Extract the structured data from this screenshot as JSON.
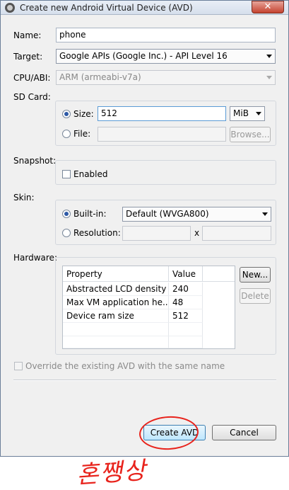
{
  "window": {
    "title": "Create new Android Virtual Device (AVD)",
    "close_glyph": "✕"
  },
  "form": {
    "name_label": "Name:",
    "name_value": "phone",
    "target_label": "Target:",
    "target_value": "Google APIs (Google Inc.) - API Level 16",
    "cpu_label": "CPU/ABI:",
    "cpu_value": "ARM (armeabi-v7a)"
  },
  "sdcard": {
    "label": "SD Card:",
    "size_option_label": "Size:",
    "size_value": "512",
    "unit_value": "MiB",
    "file_option_label": "File:",
    "file_value": "",
    "browse_label": "Browse...",
    "selected_option": "size"
  },
  "snapshot": {
    "label": "Snapshot:",
    "enabled_label": "Enabled",
    "enabled_checked": false
  },
  "skin": {
    "label": "Skin:",
    "builtin_label": "Built-in:",
    "builtin_value": "Default (WVGA800)",
    "resolution_label": "Resolution:",
    "resolution_separator": "x",
    "selected_option": "built-in"
  },
  "hardware": {
    "label": "Hardware:",
    "columns": [
      "Property",
      "Value"
    ],
    "rows": [
      {
        "property": "Abstracted LCD density",
        "value": "240"
      },
      {
        "property": "Max VM application he...",
        "value": "48"
      },
      {
        "property": "Device ram size",
        "value": "512"
      }
    ],
    "new_button_label": "New...",
    "delete_button_label": "Delete"
  },
  "override": {
    "label": "Override the existing AVD with the same name",
    "checked": false
  },
  "buttons": {
    "create_label": "Create AVD",
    "cancel_label": "Cancel"
  },
  "annotation": {
    "circle_color": "#e8231c",
    "handwritten_text": "혼쨍상",
    "handwritten_color": "#e8231c"
  },
  "colors": {
    "window_bg": "#f0f0f0",
    "primary_button": "#bee6fd",
    "radio_dot": "#2d59a6"
  }
}
